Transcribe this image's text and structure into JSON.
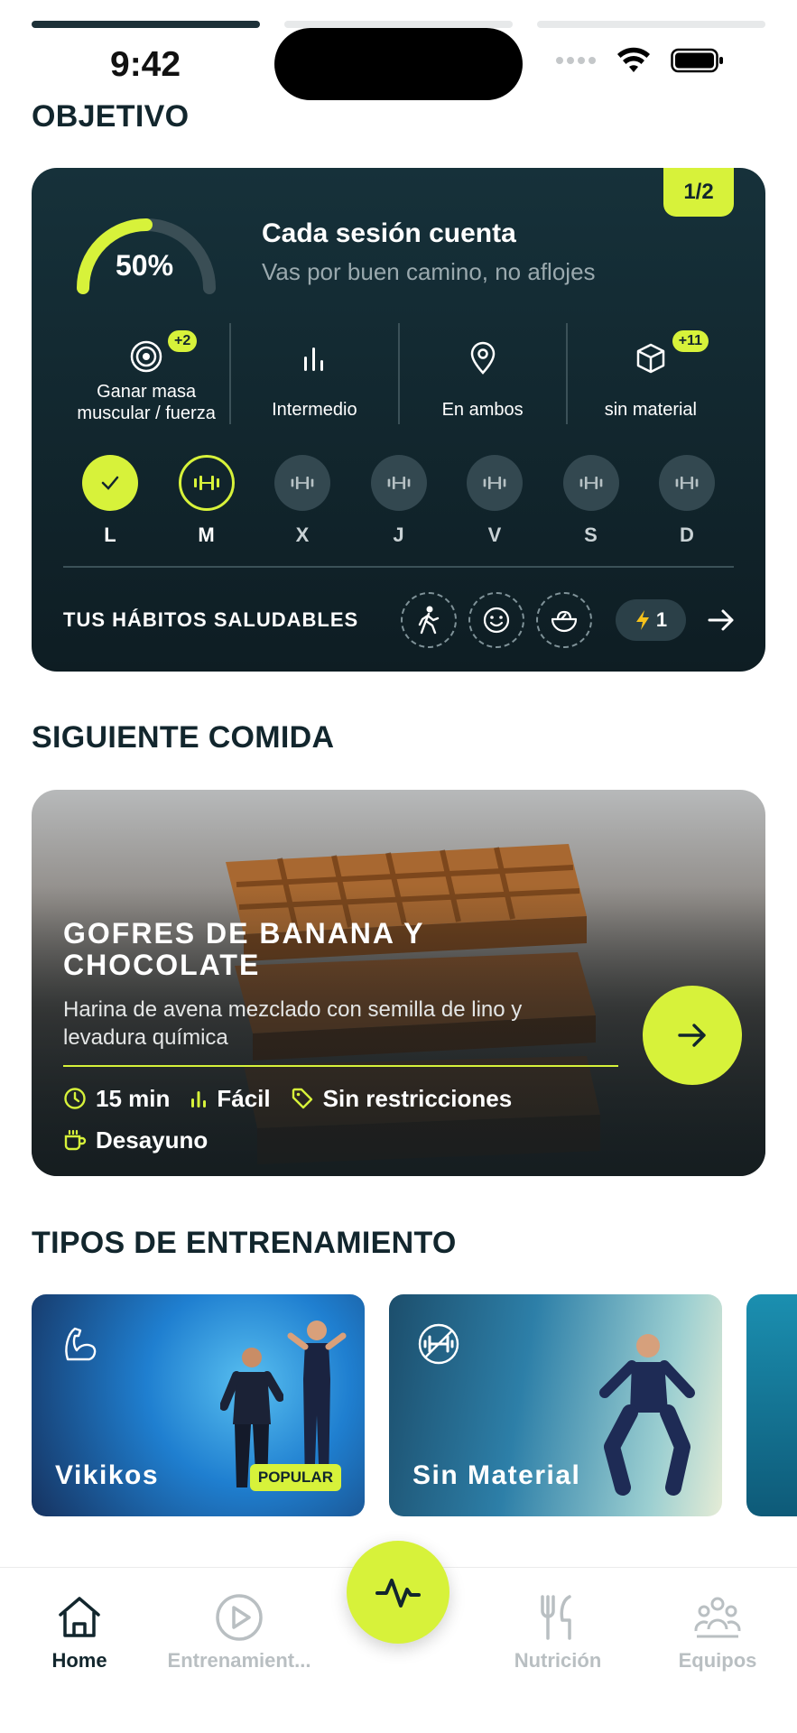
{
  "story": {
    "segments": [
      1.0,
      0.0,
      0.0
    ]
  },
  "status_bar": {
    "time": "9:42",
    "icons": [
      "cellular-icon",
      "wifi-icon",
      "battery-icon"
    ]
  },
  "objective": {
    "section_title": "OBJETIVO",
    "page_indicator": "1/2",
    "progress_percent": 50,
    "progress_label": "50%",
    "title": "Cada sesión cuenta",
    "subtitle": "Vas por buen camino, no aflojes",
    "stats": [
      {
        "icon": "target-icon",
        "label": "Ganar masa muscular / fuerza",
        "badge": "+2"
      },
      {
        "icon": "level-icon",
        "label": "Intermedio",
        "badge": ""
      },
      {
        "icon": "location-icon",
        "label": "En ambos",
        "badge": ""
      },
      {
        "icon": "box-icon",
        "label": "sin material",
        "badge": "+11"
      }
    ],
    "days": [
      {
        "label": "L",
        "state": "done"
      },
      {
        "label": "M",
        "state": "today"
      },
      {
        "label": "X",
        "state": "pending"
      },
      {
        "label": "J",
        "state": "pending"
      },
      {
        "label": "V",
        "state": "pending"
      },
      {
        "label": "S",
        "state": "pending"
      },
      {
        "label": "D",
        "state": "pending"
      }
    ],
    "habits_label": "TUS HÁBITOS SALUDABLES",
    "habit_icons": [
      "walk-icon",
      "mood-icon",
      "salad-icon"
    ],
    "streak": "1"
  },
  "meal": {
    "section_title": "SIGUIENTE COMIDA",
    "title": "GOFRES DE BANANA Y CHOCOLATE",
    "description": "Harina de avena mezclado con semilla de lino y levadura química",
    "time": "15 min",
    "difficulty": "Fácil",
    "restrictions": "Sin restricciones",
    "meal_type": "Desayuno"
  },
  "training": {
    "section_title": "TIPOS DE ENTRENAMIENTO",
    "cards": [
      {
        "name": "Vikikos",
        "badge": "POPULAR",
        "icon": "muscle-icon"
      },
      {
        "name": "Sin Material",
        "badge": "",
        "icon": "no-dumbbell-icon"
      }
    ]
  },
  "nav": {
    "items": [
      {
        "label": "Home",
        "icon": "home-icon",
        "active": true
      },
      {
        "label": "Entrenamient...",
        "icon": "play-icon",
        "active": false
      },
      {
        "label": "Nutrición",
        "icon": "cutlery-icon",
        "active": false
      },
      {
        "label": "Equipos",
        "icon": "team-icon",
        "active": false
      }
    ],
    "center_icon": "activity-icon"
  },
  "colors": {
    "accent": "#d7f23a",
    "dark": "#12262d",
    "card": "#16313a"
  }
}
